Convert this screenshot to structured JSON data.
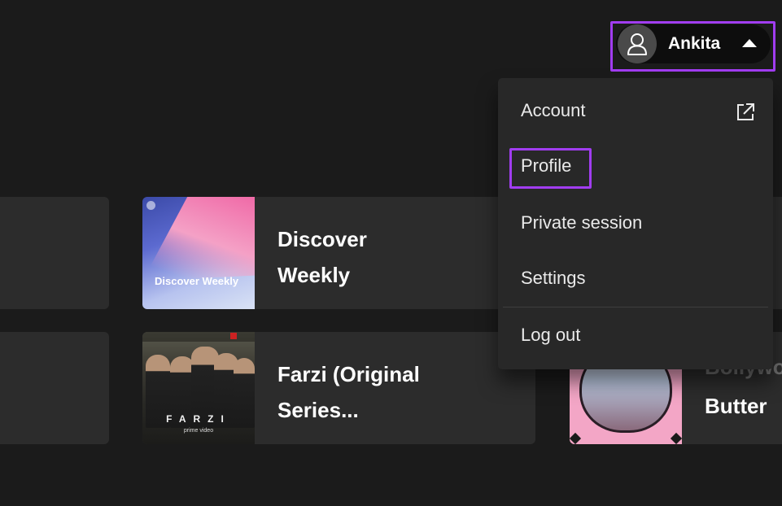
{
  "user_menu": {
    "username": "Ankita",
    "avatar_icon": "user-icon",
    "caret_icon": "caret-up-icon"
  },
  "dropdown": {
    "items": [
      {
        "label": "Account",
        "icon": "external-link-icon"
      },
      {
        "label": "Profile"
      },
      {
        "label": "Private session"
      },
      {
        "label": "Settings"
      },
      {
        "label": "Log out"
      }
    ]
  },
  "highlight_color": "#a13df0",
  "shortcuts": {
    "cards": [
      {
        "title": "Discover Weekly",
        "cover_text": "Discover Weekly"
      },
      {
        "title": "Farzi (Original Series...",
        "cover_title": "FARZI",
        "cover_subtitle": "prime video"
      },
      {
        "title_faded": "Bollywo",
        "title": "Butter"
      }
    ]
  }
}
